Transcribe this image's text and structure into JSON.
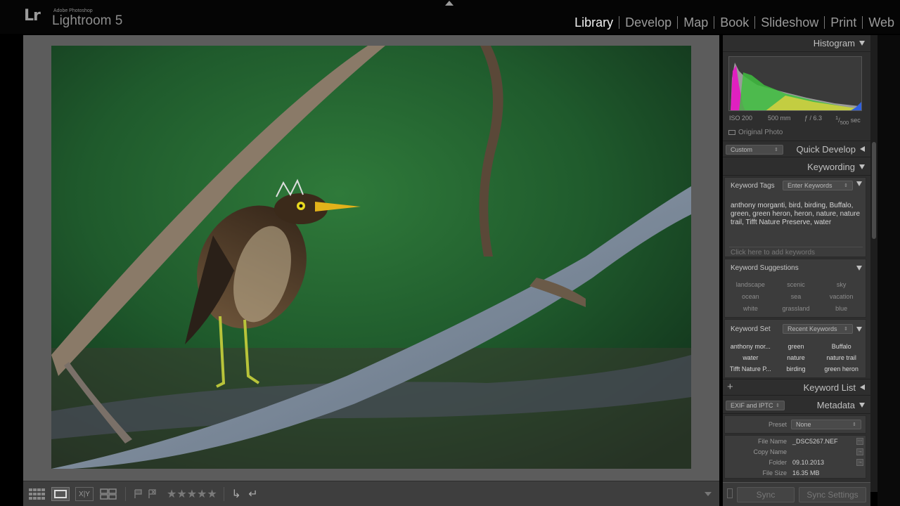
{
  "app": {
    "logo": "Lr",
    "vendor": "Adobe Photoshop",
    "product": "Lightroom 5"
  },
  "modules": [
    "Library",
    "Develop",
    "Map",
    "Book",
    "Slideshow",
    "Print",
    "Web"
  ],
  "active_module": "Library",
  "panels": {
    "histogram": {
      "title": "Histogram",
      "iso": "ISO 200",
      "focal": "500 mm",
      "aperture": "ƒ / 6.3",
      "shutter_num": "1",
      "shutter_den": "500",
      "shutter_unit": "sec",
      "original_photo": "Original Photo"
    },
    "quick_develop": {
      "title": "Quick Develop",
      "preset": "Custom"
    },
    "keywording": {
      "title": "Keywording",
      "keyword_tags_label": "Keyword Tags",
      "keyword_tags_mode": "Enter Keywords",
      "keywords_text": "anthony morganti, bird, birding, Buffalo, green, green heron, heron, nature, nature trail, Tifft Nature Preserve, water",
      "add_placeholder": "Click here to add keywords",
      "suggestions_label": "Keyword Suggestions",
      "suggestions": [
        "landscape",
        "scenic",
        "sky",
        "ocean",
        "sea",
        "vacation",
        "white",
        "grassland",
        "blue"
      ],
      "keyword_set_label": "Keyword Set",
      "keyword_set_value": "Recent Keywords",
      "keyword_set": [
        "anthony mor...",
        "green",
        "Buffalo",
        "water",
        "nature",
        "nature trail",
        "Tifft Nature P...",
        "birding",
        "green heron"
      ]
    },
    "keyword_list": {
      "title": "Keyword List",
      "add": "+"
    },
    "metadata": {
      "title": "Metadata",
      "view": "EXIF and IPTC",
      "preset_label": "Preset",
      "preset_value": "None",
      "rows": [
        {
          "label": "File Name",
          "value": "_DSC5267.NEF"
        },
        {
          "label": "Copy Name",
          "value": ""
        },
        {
          "label": "Folder",
          "value": "09.10.2013"
        },
        {
          "label": "File Size",
          "value": "16.35 MB"
        }
      ]
    }
  },
  "sync": {
    "sync_label": "Sync",
    "sync_settings_label": "Sync Settings"
  },
  "toolbar": {
    "stars": "★★★★★",
    "compare_label": "X|Y"
  },
  "histogram_colors": {
    "magenta": "#e020c0",
    "green": "#3fbf3f",
    "yellow": "#d8d040",
    "gray": "#9a9a9a",
    "blue": "#3060e0"
  }
}
